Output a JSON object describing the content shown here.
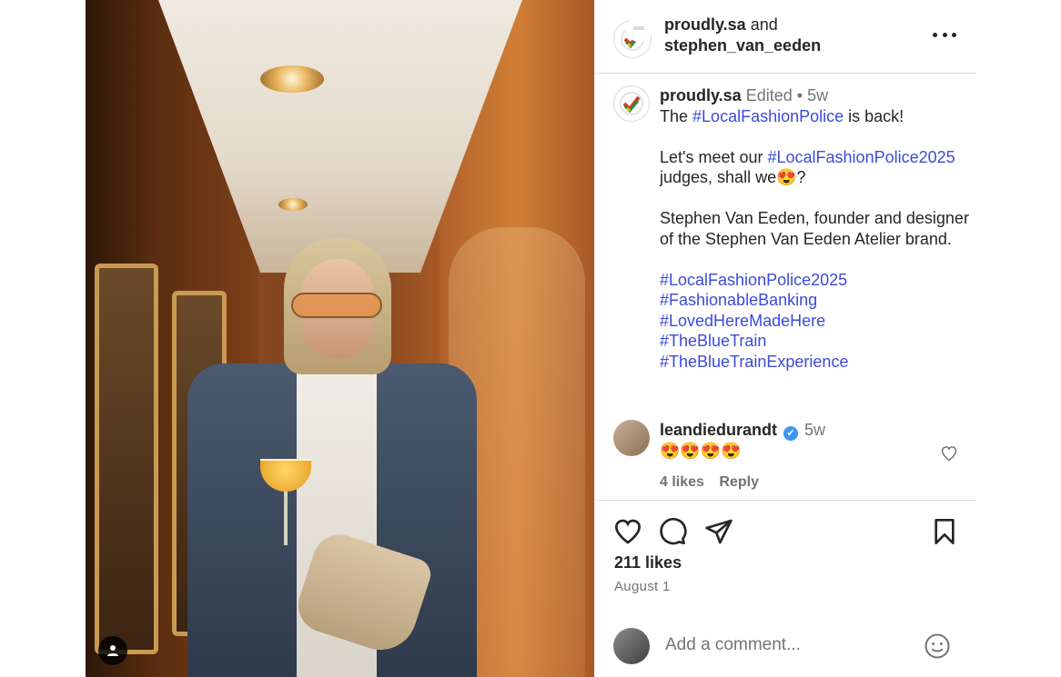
{
  "header": {
    "user1": "proudly.sa",
    "and_text": "and",
    "user2": "stephen_van_eeden",
    "more_icon": "more-horizontal-icon"
  },
  "caption": {
    "username": "proudly.sa",
    "edited": "Edited",
    "dot": "•",
    "time": "5w",
    "line1_pre": "The ",
    "line1_tag": "#LocalFashionPolice",
    "line1_post": " is back!",
    "line2_pre": "Let's meet our ",
    "line2_tag": "#LocalFashionPolice2025",
    "line3": "judges, shall we😍?",
    "para3": "Stephen Van Eeden, founder and designer of the Stephen Van Eeden Atelier brand.",
    "hashtags": [
      "#LocalFashionPolice2025",
      "#FashionableBanking",
      "#LovedHereMadeHere",
      "#TheBlueTrain",
      "#TheBlueTrainExperience"
    ]
  },
  "comment": {
    "username": "leandiedurandt",
    "verified_icon": "✔",
    "time": "5w",
    "text": "😍😍😍😍",
    "likes": "4 likes",
    "reply": "Reply"
  },
  "actions": {
    "likes": "211 likes",
    "date": "August 1",
    "comment_placeholder": "Add a comment..."
  },
  "colors": {
    "link": "#3b4bd8",
    "verified": "#3897f0",
    "muted": "#737373"
  }
}
